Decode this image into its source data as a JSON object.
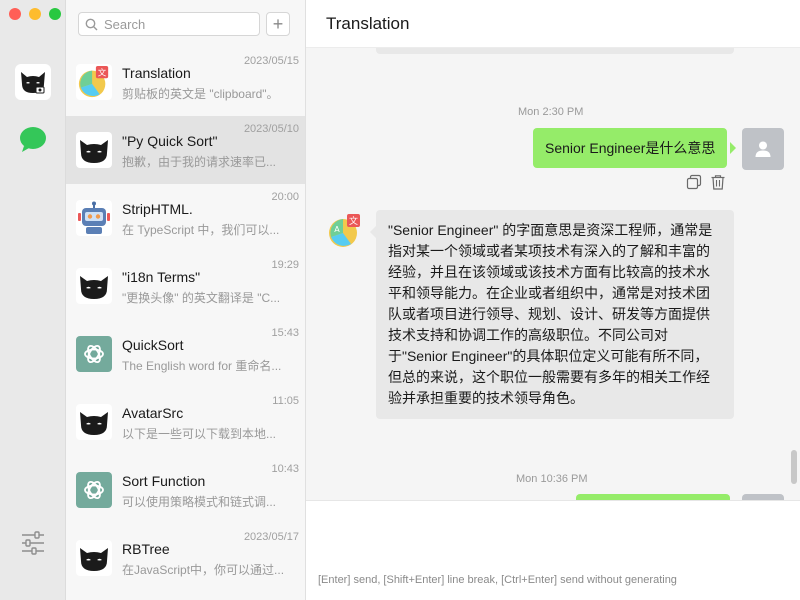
{
  "list": {
    "search_placeholder": "Search",
    "add_label": "+",
    "items": [
      {
        "title": "Translation",
        "preview": "剪贴板的英文是 \"clipboard\"。",
        "time": "2023/05/15",
        "avatar": "translate-icon",
        "active": false
      },
      {
        "title": "\"Py Quick Sort\"",
        "preview": "抱歉，由于我的请求速率已...",
        "time": "2023/05/10",
        "avatar": "cat-icon",
        "active": true
      },
      {
        "title": "StripHTML.",
        "preview": "在 TypeScript 中，我们可以...",
        "time": "20:00",
        "avatar": "robot-icon",
        "active": false
      },
      {
        "title": "\"i18n Terms\"",
        "preview": "\"更换头像\" 的英文翻译是 \"C...",
        "time": "19:29",
        "avatar": "cat-icon",
        "active": false
      },
      {
        "title": "QuickSort",
        "preview": "The English word for 重命名...",
        "time": "15:43",
        "avatar": "openai-icon",
        "active": false
      },
      {
        "title": "AvatarSrc",
        "preview": "以下是一些可以下载到本地...",
        "time": "11:05",
        "avatar": "cat-icon",
        "active": false
      },
      {
        "title": "Sort Function",
        "preview": "可以使用策略模式和链式调...",
        "time": "10:43",
        "avatar": "openai-icon",
        "active": false
      },
      {
        "title": "RBTree",
        "preview": "在JavaScript中，你可以通过...",
        "time": "2023/05/17",
        "avatar": "cat-icon",
        "active": false
      }
    ]
  },
  "chat": {
    "title": "Translation",
    "messages": [
      {
        "timestamp": "Mon 2:30 PM"
      },
      {
        "role": "user",
        "text": "Senior Engineer是什么意思"
      },
      {
        "role": "assistant",
        "lines": [
          "\"Senior Engineer\" 的字面意思是资深工程师，通常是",
          "指对某一个领域或者某项技术有深入的了解和丰富的",
          "经验，并且在该领域或该技术方面有比较高的技术水",
          "平和领导能力。在企业或者组织中，通常是对技术团",
          "队或者项目进行领导、规划、设计、研发等方面提供",
          "技术支持和协调工作的高级职位。不同公司对",
          "于\"Senior Engineer\"的具体职位定义可能有所不同，",
          "但总的来说，这个职位一般需要有多年的相关工作经",
          "验并承担重要的技术领导角色。"
        ]
      },
      {
        "timestamp": "Mon 10:36 PM"
      }
    ],
    "composer_hint": "[Enter] send, [Shift+Enter] line break, [Ctrl+Enter] send without generating"
  },
  "colors": {
    "user_bubble": "#95ec69",
    "bot_bubble": "#e8e8e8",
    "active_item": "#e3e3e3",
    "chat_icon": "#34c759"
  }
}
